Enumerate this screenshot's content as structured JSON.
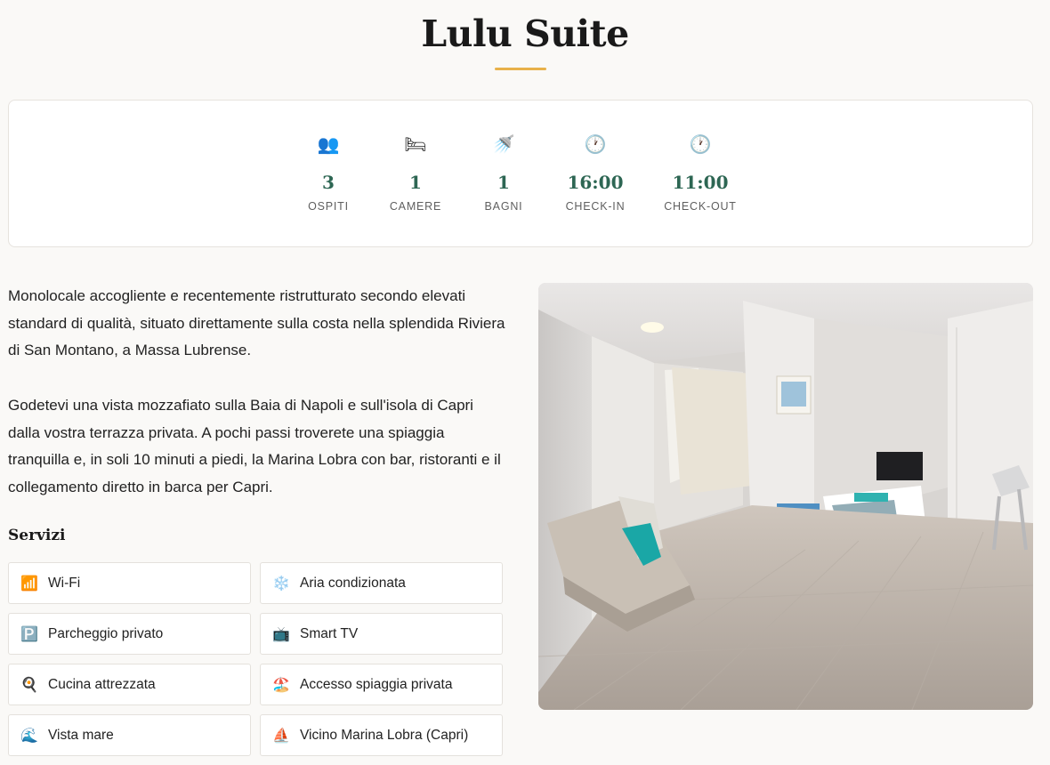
{
  "title": "Lulu Suite",
  "stats": [
    {
      "icon": "👥",
      "icon_name": "guests-icon",
      "value": "3",
      "label": "OSPITI"
    },
    {
      "icon": "🛏",
      "icon_name": "bed-icon",
      "value": "1",
      "label": "CAMERE"
    },
    {
      "icon": "🚿",
      "icon_name": "shower-icon",
      "value": "1",
      "label": "BAGNI"
    },
    {
      "icon": "🕐",
      "icon_name": "clock-icon",
      "value": "16:00",
      "label": "CHECK-IN"
    },
    {
      "icon": "🕐",
      "icon_name": "clock-icon",
      "value": "11:00",
      "label": "CHECK-OUT"
    }
  ],
  "description": {
    "p1": "Monolocale accogliente e recentemente ristrutturato secondo elevati standard di qualità, situato direttamente sulla costa nella splendida Riviera di San Montano, a Massa Lubrense.",
    "p2": "Godetevi una vista mozzafiato sulla Baia di Napoli e sull'isola di Capri dalla vostra terrazza privata. A pochi passi troverete una spiaggia tranquilla e, in soli 10 minuti a piedi, la Marina Lobra con bar, ristoranti e il collegamento diretto in barca per Capri."
  },
  "services": {
    "title": "Servizi",
    "items": [
      {
        "icon": "📶",
        "icon_name": "wifi-icon",
        "label": "Wi-Fi"
      },
      {
        "icon": "❄️",
        "icon_name": "snowflake-icon",
        "label": "Aria condizionata"
      },
      {
        "icon": "🅿️",
        "icon_name": "parking-icon",
        "label": "Parcheggio privato"
      },
      {
        "icon": "📺",
        "icon_name": "tv-icon",
        "label": "Smart TV"
      },
      {
        "icon": "🍳",
        "icon_name": "frying-pan-icon",
        "label": "Cucina attrezzata"
      },
      {
        "icon": "🏖️",
        "icon_name": "beach-icon",
        "label": "Accesso spiaggia privata"
      },
      {
        "icon": "🌊",
        "icon_name": "wave-icon",
        "label": "Vista mare"
      },
      {
        "icon": "⛵",
        "icon_name": "sailboat-icon",
        "label": "Vicino Marina Lobra (Capri)"
      }
    ]
  },
  "colors": {
    "accent": "#e8b14a",
    "stat_value": "#2d6653",
    "background": "#faf9f7"
  }
}
